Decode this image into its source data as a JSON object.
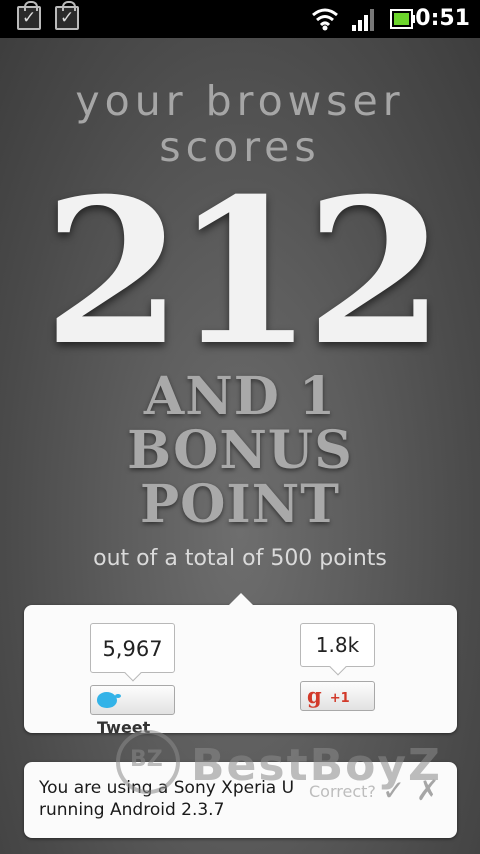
{
  "status_bar": {
    "time": "0:51",
    "icons": [
      "shopping-bag-check-icon",
      "shopping-bag-check-icon",
      "wifi-icon",
      "signal-icon",
      "battery-icon"
    ]
  },
  "result": {
    "headline_line1": "your browser",
    "headline_line2": "scores",
    "score": "212",
    "bonus_line1": "AND 1",
    "bonus_line2": "BONUS",
    "bonus_line3": "POINT",
    "total": "out of a total of 500 points"
  },
  "social": {
    "tweet_count": "5,967",
    "tweet_label": "Tweet",
    "gplus_count": "1.8k",
    "gplus_label": "+1"
  },
  "device": {
    "line1": "You are using a Sony Xperia U",
    "line2": "running Android 2.3.7",
    "correct_label": "Correct?"
  },
  "watermark": {
    "text": "BestBoyZ"
  },
  "colors": {
    "background": "#5d5d5d",
    "panel": "#fbfbfb",
    "score_text": "#f2f2f2",
    "twitter_blue": "#33b3e8",
    "gplus_red": "#d23a2a"
  }
}
